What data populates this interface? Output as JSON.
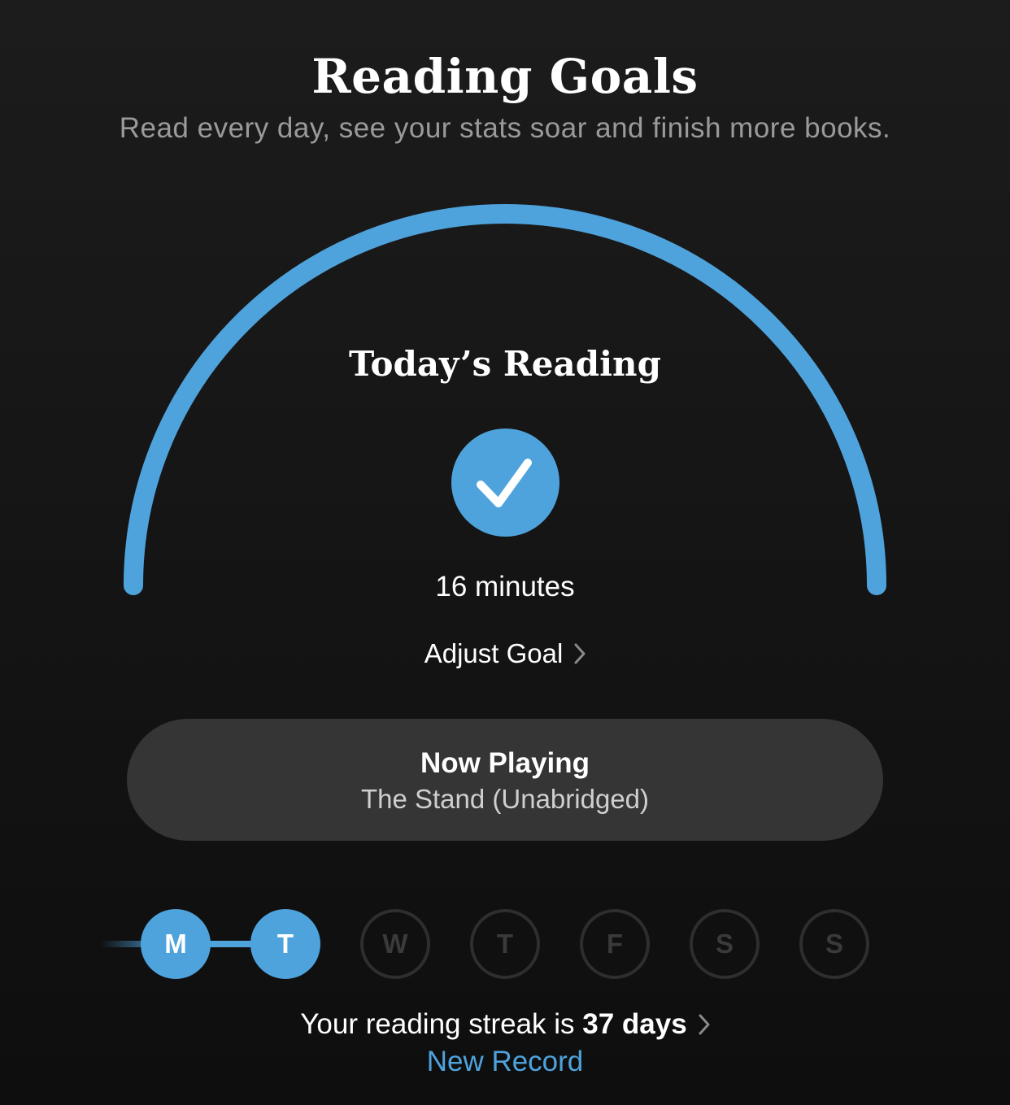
{
  "header": {
    "title": "Reading Goals",
    "subtitle": "Read every day, see your stats soar and finish more books."
  },
  "today": {
    "label": "Today’s Reading",
    "minutes": "16 minutes",
    "goal_progress": 1.0,
    "status_icon": "checkmark-icon",
    "adjust_label": "Adjust Goal"
  },
  "now_playing": {
    "label": "Now Playing",
    "book": "The Stand (Unabridged)"
  },
  "week": {
    "days": [
      {
        "letter": "M",
        "done": true
      },
      {
        "letter": "T",
        "done": true
      },
      {
        "letter": "W",
        "done": false
      },
      {
        "letter": "T",
        "done": false
      },
      {
        "letter": "F",
        "done": false
      },
      {
        "letter": "S",
        "done": false
      },
      {
        "letter": "S",
        "done": false
      }
    ]
  },
  "streak": {
    "prefix": "Your reading streak is ",
    "value": "37 days",
    "badge": "New Record"
  },
  "colors": {
    "accent": "#4fa3dd",
    "background": "#161616",
    "card": "#353535",
    "muted_text": "#9a9a9a"
  }
}
